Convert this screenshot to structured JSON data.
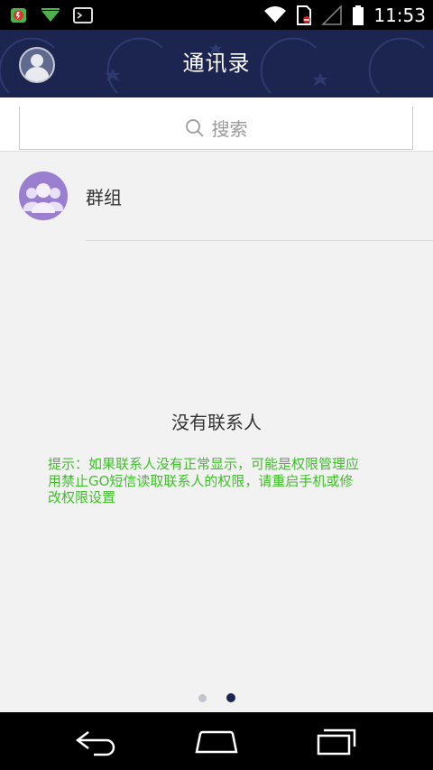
{
  "status_bar": {
    "time": "11:53",
    "left_icons": [
      "app-notification-icon",
      "download-icon",
      "terminal-icon"
    ],
    "right_icons": [
      "wifi-icon",
      "sim-blocked-icon",
      "signal-icon",
      "battery-icon"
    ]
  },
  "header": {
    "title": "通讯录",
    "avatar_icon": "user-avatar-icon"
  },
  "search": {
    "placeholder": "搜索",
    "icon": "search-icon"
  },
  "contacts": {
    "group_label": "群组",
    "group_icon": "group-avatar-icon"
  },
  "empty_state": {
    "title": "没有联系人",
    "hint_lines": [
      "提示：如果联系人没有正常显示，可能是权限管理应",
      "用禁止GO短信读取联系人的权限，请重启手机或修",
      "改权限设置"
    ]
  },
  "pager": {
    "total": 2,
    "active": 2
  },
  "nav_bar": {
    "icons": [
      "back-icon",
      "home-icon",
      "recent-apps-icon"
    ]
  },
  "colors": {
    "header_bg": "#1c2450",
    "hint_text": "#3fbf2a",
    "group_avatar": "#9a7fd0"
  }
}
